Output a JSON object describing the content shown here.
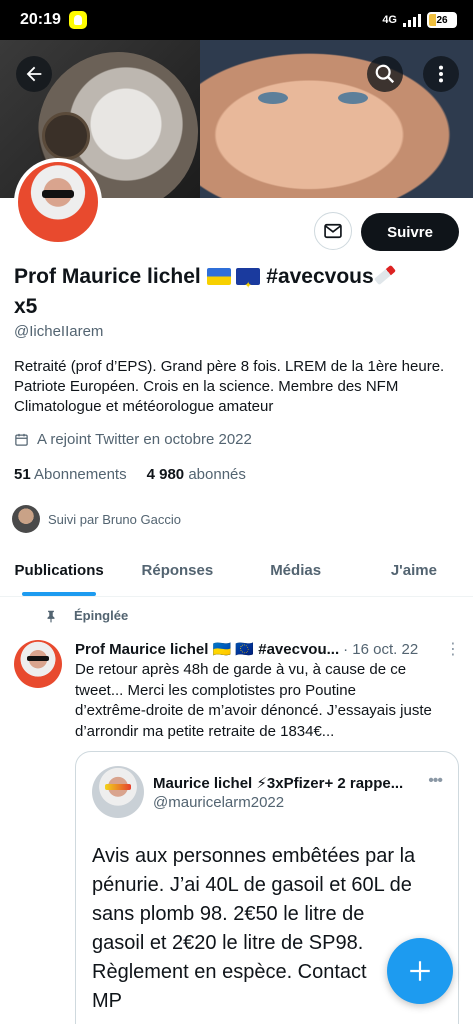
{
  "status_bar": {
    "time": "20:19",
    "network": "4G",
    "battery": "26"
  },
  "profile": {
    "name_text": "Prof Maurice lichel",
    "name_hashtag": "#avecvous",
    "name_suffix": "x5",
    "handle": "@IicheIIarem",
    "bio_line1": "Retraité (prof d’EPS). Grand père 8 fois. LREM de la 1ère heure.",
    "bio_line2": "Patriote Européen. Crois en la science. Membre des NFM",
    "bio_line3": "Climatologue et météorologue amateur",
    "joined": "A rejoint Twitter en octobre 2022",
    "following_count": "51",
    "following_label": "Abonnements",
    "followers_count": "4 980",
    "followers_label": "abonnés",
    "followed_by": "Suivi par Bruno Gaccio",
    "follow_button": "Suivre"
  },
  "tabs": [
    {
      "label": "Publications",
      "active": true
    },
    {
      "label": "Réponses",
      "active": false
    },
    {
      "label": "Médias",
      "active": false
    },
    {
      "label": "J'aime",
      "active": false
    }
  ],
  "tweet": {
    "pinned_label": "Épinglée",
    "author": "Prof Maurice lichel 🇺🇦 🇪🇺 #avecvou...",
    "date": "· 16 oct. 22",
    "text_line1": "De retour après 48h de garde à vu, à cause de ce",
    "text_line2": "tweet... Merci les complotistes pro Poutine",
    "text_line3": "d’extrême-droite de m’avoir dénoncé. J’essayais juste",
    "text_line4": "d’arrondir ma petite retraite de 1834€...",
    "quote": {
      "name": "Maurice lichel ⚡3xPfizer+ 2 rappe...",
      "handle": "@mauricelarm2022",
      "line1": "Avis aux personnes embêtées par la",
      "line2": "pénurie. J’ai 40L de gasoil et 60L de",
      "line3": "sans plomb 98. 2€50 le litre de",
      "line4": "gasoil et 2€20 le litre de SP98.",
      "line5": "Règlement en espèce. Contact",
      "line6": "MP"
    }
  },
  "colors": {
    "accent": "#1d9bf0",
    "text": "#0f1419",
    "secondary": "#536471"
  }
}
